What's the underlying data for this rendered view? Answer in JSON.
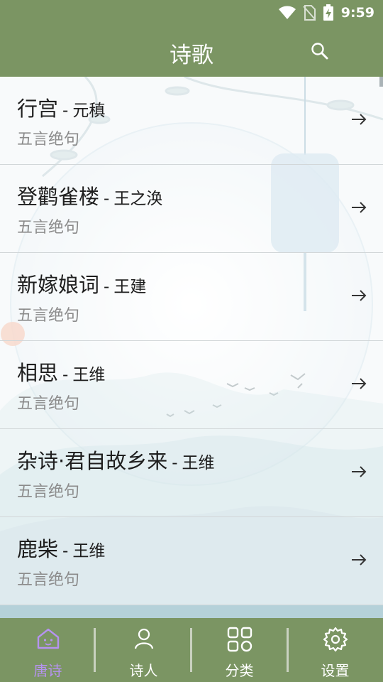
{
  "status_bar": {
    "time": "9:59",
    "icons": [
      "wifi-icon",
      "no-sim-icon",
      "battery-charging-icon"
    ]
  },
  "app_bar": {
    "title": "诗歌",
    "search_icon": "search-icon"
  },
  "colors": {
    "primary": "#7b9563",
    "active_tab": "#b693f0",
    "secondary_text": "#8b8b8b"
  },
  "poems": [
    {
      "title": "行宫",
      "separator": "-",
      "author": "元稹",
      "type": "五言绝句"
    },
    {
      "title": "登鹳雀楼",
      "separator": "-",
      "author": "王之涣",
      "type": "五言绝句"
    },
    {
      "title": "新嫁娘词",
      "separator": "-",
      "author": "王建",
      "type": "五言绝句"
    },
    {
      "title": "相思",
      "separator": "-",
      "author": "王维",
      "type": "五言绝句"
    },
    {
      "title": "杂诗·君自故乡来",
      "separator": "-",
      "author": "王维",
      "type": "五言绝句"
    },
    {
      "title": "鹿柴",
      "separator": "-",
      "author": "王维",
      "type": "五言绝句"
    }
  ],
  "tabs": [
    {
      "label": "唐诗",
      "icon": "home-cat-icon",
      "active": true
    },
    {
      "label": "诗人",
      "icon": "person-icon",
      "active": false
    },
    {
      "label": "分类",
      "icon": "grid-icon",
      "active": false
    },
    {
      "label": "设置",
      "icon": "gear-icon",
      "active": false
    }
  ]
}
